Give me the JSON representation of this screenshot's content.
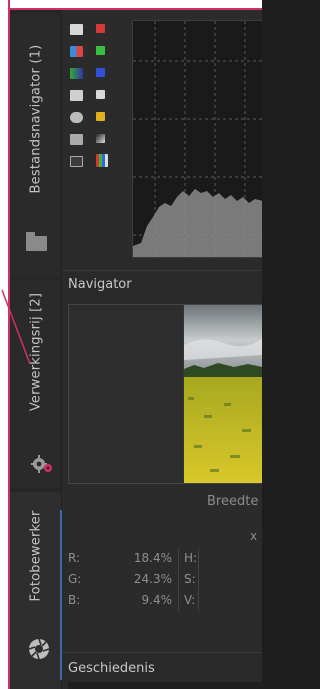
{
  "tabs": {
    "files": "Bestandsnavigator (1)",
    "queue": "Verwerkingsrij [2]",
    "editor": "Fotobewerker"
  },
  "navigator": {
    "title": "Navigator",
    "width_label": "Breedte",
    "x_label": "x"
  },
  "readout": {
    "rows": [
      {
        "label": "R:",
        "value": "18.4%",
        "label2": "H:"
      },
      {
        "label": "G:",
        "value": "24.3%",
        "label2": "S:"
      },
      {
        "label": "B:",
        "value": "9.4%",
        "label2": "V:"
      }
    ]
  },
  "history": {
    "title": "Geschiedenis"
  },
  "colors": {
    "accent": "#3a6aa8",
    "annotation": "#d0306a"
  },
  "icons": {
    "files_tab": "folder-icon",
    "queue_tab": "gears-icon",
    "editor_tab": "aperture-icon"
  }
}
